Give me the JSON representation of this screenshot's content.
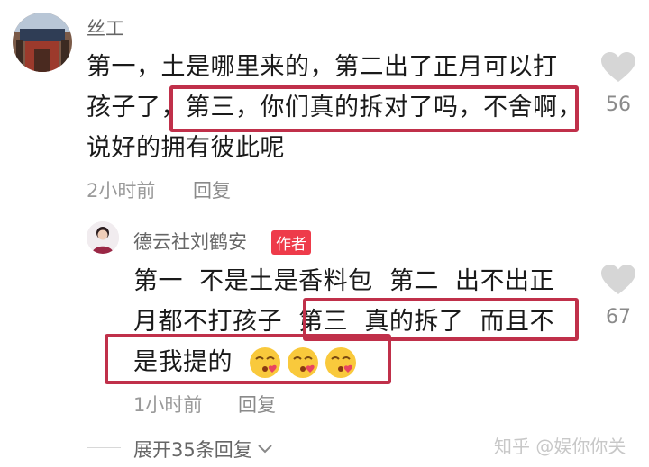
{
  "comment": {
    "username": "丝工",
    "lines": [
      "第一，土是哪里来的，第二出了正月可以打",
      "孩子了，第三，你们真的拆对了吗，不舍啊，",
      "说好的拥有彼此呢"
    ],
    "time": "2小时前",
    "reply_label": "回复",
    "likes": "56"
  },
  "reply": {
    "username": "德云社刘鹤安",
    "author_badge": "作者",
    "lines": [
      "第一  不是土是香料包  第二  出不出正",
      "月都不打孩子  第三  真的拆了  而且不",
      "是我提的"
    ],
    "time": "1小时前",
    "reply_label": "回复",
    "likes": "67"
  },
  "expand_label": "展开35条回复",
  "watermark": "知乎 @娱你你关",
  "colors": {
    "highlight": "#c0304a",
    "badge": "#ee3b4a",
    "heart": "#d6d6d6"
  },
  "icons": [
    "heart-icon",
    "chevron-down-icon",
    "blowing-kiss-emoji"
  ]
}
